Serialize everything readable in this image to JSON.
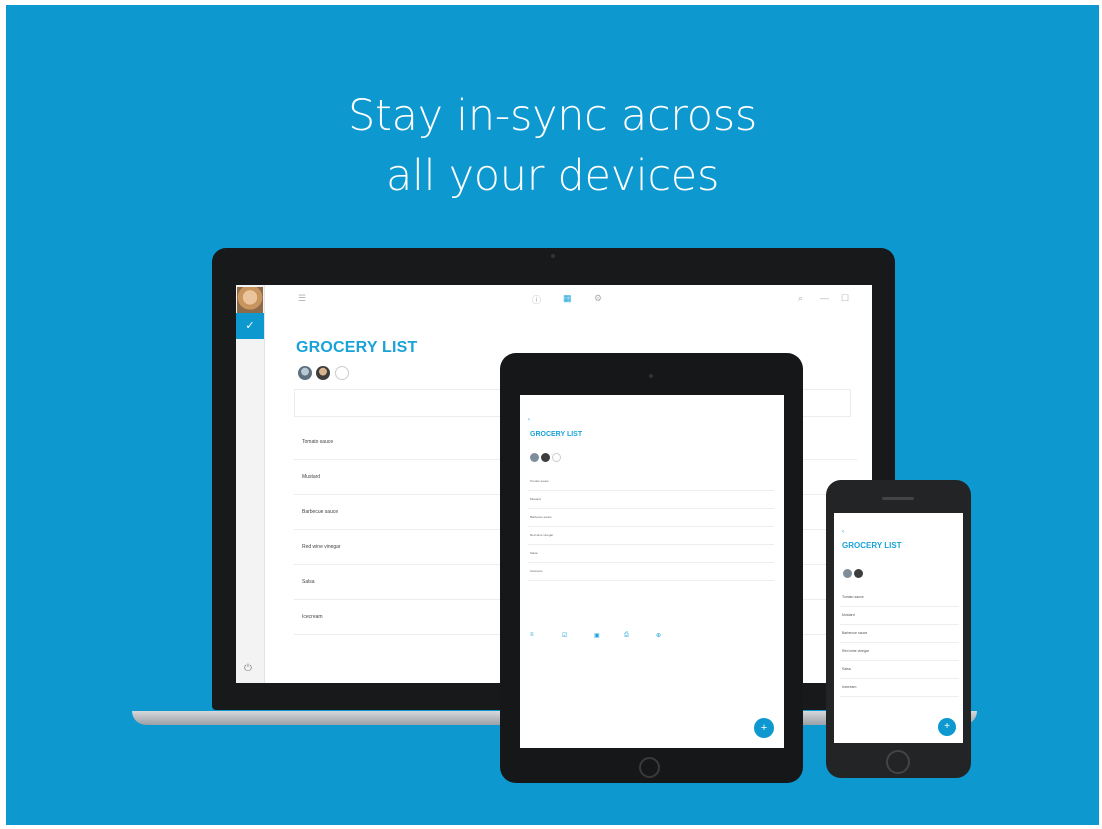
{
  "headline": {
    "line1": "Stay in-sync across",
    "line2": "all your devices"
  },
  "colors": {
    "background": "#0d98cf",
    "accent": "#1aa3d9",
    "text_on_bg": "#ffffff"
  },
  "list": {
    "title": "GROCERY LIST",
    "items": [
      "Tomato sauce",
      "Mustard",
      "Barbecue sauce",
      "Red wine vinegar",
      "Salsa",
      "Icecream"
    ]
  },
  "icons": {
    "menu": "menu-icon",
    "check": "check-icon",
    "power": "power-icon",
    "add": "plus-icon",
    "search": "search-icon"
  },
  "fab_label": "+"
}
